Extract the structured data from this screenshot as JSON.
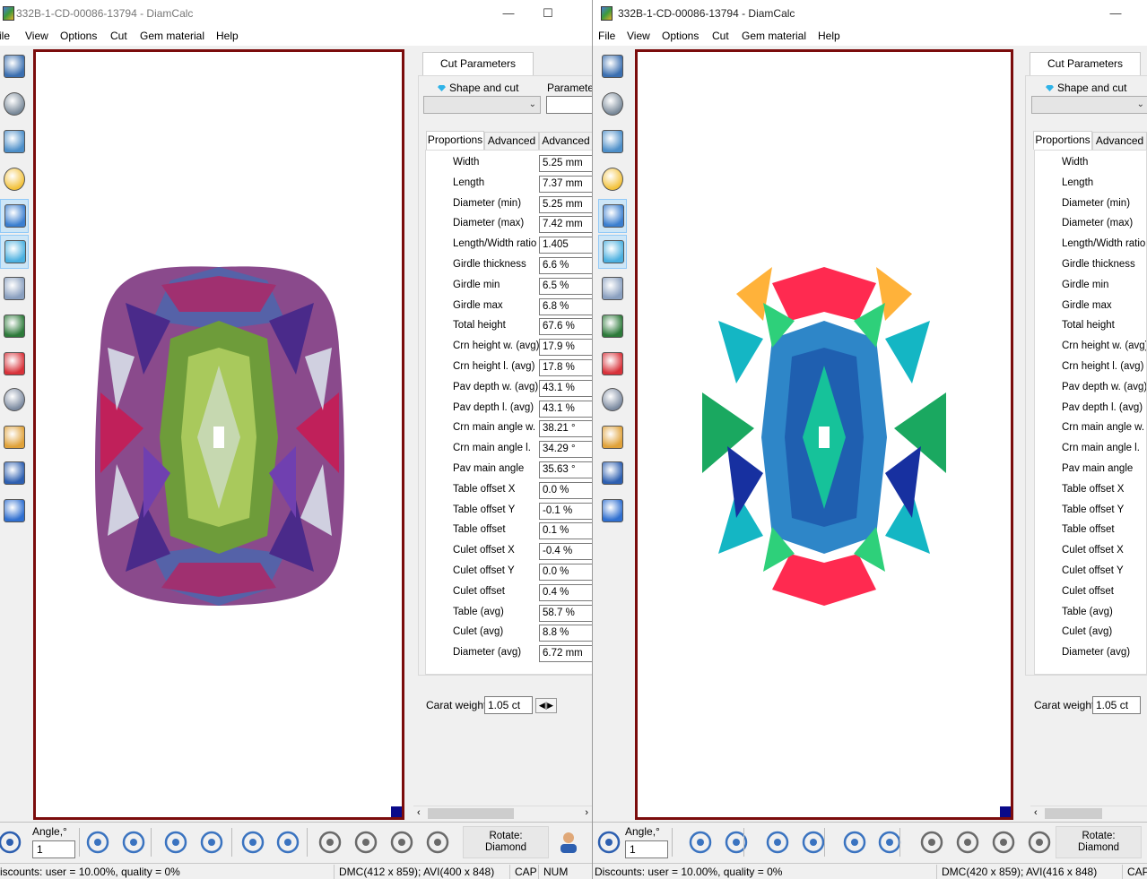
{
  "windows": [
    {
      "id": "left",
      "title": "332B-1-CD-00086-13794 - DiamCalc",
      "menu": [
        "ile",
        "View",
        "Options",
        "Cut",
        "Gem material",
        "Help"
      ],
      "panel": {
        "tab": "Cut Parameters",
        "shape_label": "Shape and cut",
        "parameter_label": "Parameter",
        "subtabs": [
          "Proportions",
          "Advanced",
          "Advanced"
        ],
        "carat_label": "Carat weight",
        "carat_value": "1.05 ct"
      },
      "bottom": {
        "angle_label": "Angle,°",
        "angle_value": "1",
        "rotate_label": "Rotate:",
        "rotate_value": "Diamond"
      },
      "status": {
        "discounts": "iscounts: user = 10.00%, quality = 0%",
        "dims": "DMC(412 x 859); AVI(400 x 848)",
        "cap": "CAP",
        "num": "NUM"
      }
    },
    {
      "id": "right",
      "title": "332B-1-CD-00086-13794 - DiamCalc",
      "menu": [
        "File",
        "View",
        "Options",
        "Cut",
        "Gem material",
        "Help"
      ],
      "panel": {
        "tab": "Cut Parameters",
        "shape_label": "Shape and cut",
        "subtabs": [
          "Proportions",
          "Advanced"
        ],
        "carat_label": "Carat weight",
        "carat_value": "1.05 ct"
      },
      "bottom": {
        "angle_label": "Angle,°",
        "angle_value": "1",
        "rotate_label": "Rotate:",
        "rotate_value": "Diamond"
      },
      "status": {
        "discounts": "Discounts: user = 10.00%, quality = 0%",
        "dims": "DMC(420 x 859); AVI(416 x 848)",
        "cap": "CAP"
      }
    }
  ],
  "proportions": [
    {
      "label": "Width",
      "value": "5.25 mm"
    },
    {
      "label": "Length",
      "value": "7.37 mm"
    },
    {
      "label": "Diameter (min)",
      "value": "5.25 mm"
    },
    {
      "label": "Diameter (max)",
      "value": "7.42 mm"
    },
    {
      "label": "Length/Width ratio",
      "value": "1.405"
    },
    {
      "label": "Girdle thickness",
      "value": "6.6 %"
    },
    {
      "label": "Girdle min",
      "value": "6.5 %"
    },
    {
      "label": "Girdle max",
      "value": "6.8 %"
    },
    {
      "label": "Total height",
      "value": "67.6 %"
    },
    {
      "label": "Crn height w. (avg)",
      "value": "17.9 %"
    },
    {
      "label": "Crn height l. (avg)",
      "value": "17.8 %"
    },
    {
      "label": "Pav depth w. (avg)",
      "value": "43.1 %"
    },
    {
      "label": "Pav depth l. (avg)",
      "value": "43.1 %"
    },
    {
      "label": "Crn main angle w.",
      "value": "38.21 °"
    },
    {
      "label": "Crn main angle l.",
      "value": "34.29 °"
    },
    {
      "label": "Pav main angle",
      "value": "35.63 °"
    },
    {
      "label": "Table offset X",
      "value": "0.0 %"
    },
    {
      "label": "Table offset Y",
      "value": "-0.1 %"
    },
    {
      "label": "Table offset",
      "value": "0.1 %"
    },
    {
      "label": "Culet offset X",
      "value": "-0.4 %"
    },
    {
      "label": "Culet offset Y",
      "value": "0.0 %"
    },
    {
      "label": "Culet offset",
      "value": "0.4 %"
    },
    {
      "label": "Table (avg)",
      "value": "58.7 %"
    },
    {
      "label": "Culet (avg)",
      "value": "8.8 %"
    },
    {
      "label": "Diameter (avg)",
      "value": "6.72 mm"
    }
  ],
  "colors": {
    "frame_border": "#7b0c0c",
    "active_tool": "#cde6f7",
    "corner_marker": "#0a0a8a"
  },
  "icons": {
    "side_tools": [
      "diamond-outline-icon",
      "diamond-sphere-icon",
      "paint-bucket-icon",
      "light-bulb-icon",
      "diamond-render-icon",
      "spectrum-icon",
      "diamond-photo-icon",
      "film-play-icon",
      "film-record-icon",
      "diamond-wheel-icon",
      "open-folder-icon",
      "save-disk-icon",
      "word-export-icon"
    ],
    "bottom_tools": [
      "zoom-icon",
      "rotate-ccw-icon",
      "rotate-cw-icon",
      "flip-left-icon",
      "flip-right-icon",
      "tilt-left-icon",
      "tilt-right-icon",
      "top-view-icon",
      "side-view-icon",
      "bottom-view-icon",
      "profile-view-icon",
      "user-rotate-icon"
    ]
  }
}
